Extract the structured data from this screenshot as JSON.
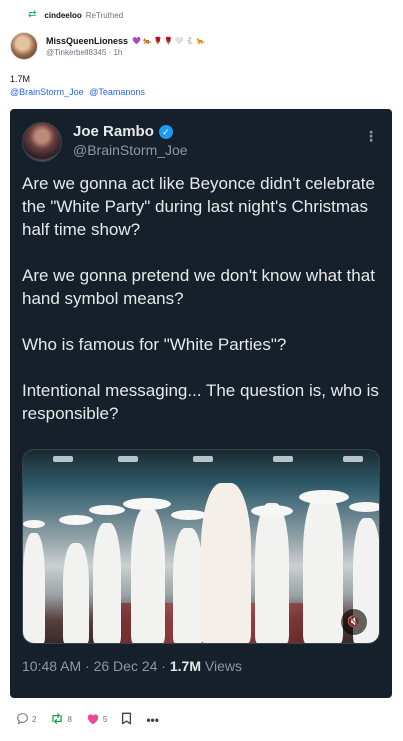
{
  "retruth": {
    "icon": "retruth-icon",
    "user": "cindeeloo",
    "label": "ReTruthed"
  },
  "post": {
    "author_name": "MissQueenLioness",
    "author_emojis": [
      "💜",
      "🐅",
      "🌹",
      "🌹",
      "🤍",
      "🐇",
      "🐆"
    ],
    "handle": "@Tinkerbell8345",
    "separator": "·",
    "time": "1h",
    "caption_number": "1.7M",
    "mentions": [
      "@BrainStorm_Joe",
      "@Teamanons"
    ]
  },
  "tweet": {
    "name": "Joe Rambo",
    "verified_icon": "✓",
    "handle": "@BrainStorm_Joe",
    "more_icon": "⋮",
    "paragraphs": [
      "Are we gonna act like Beyonce didn't celebrate the \"White Party\" during last night's Christmas half time show?",
      "Are we gonna pretend we don't know what that hand symbol means?",
      "Who is famous for \"White Parties\"?",
      "Intentional messaging... The question is, who is responsible?"
    ],
    "footer_time": "10:48 AM · 26 Dec 24 · ",
    "views_number": "1.7M",
    "views_label": " Views",
    "volume_icon": "🔇"
  },
  "actions": {
    "reply_count": "2",
    "retruth_count": "8",
    "like_count": "5",
    "more_label": "•••"
  }
}
